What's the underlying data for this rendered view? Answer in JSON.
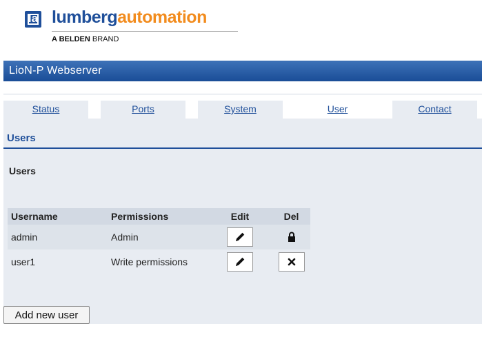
{
  "brand": {
    "name_part1": "lumberg",
    "name_part2": "automation",
    "tagline_bold": "A BELDEN",
    "tagline_rest": " BRAND",
    "mark": "la"
  },
  "header": {
    "title": "LioN-P Webserver"
  },
  "tabs": [
    {
      "label": "Status",
      "active": false
    },
    {
      "label": "Ports",
      "active": false
    },
    {
      "label": "System",
      "active": false
    },
    {
      "label": "User",
      "active": true
    },
    {
      "label": "Contact",
      "active": false
    }
  ],
  "section": {
    "title": "Users",
    "subtitle": "Users"
  },
  "table": {
    "headers": [
      "Username",
      "Permissions",
      "Edit",
      "Del"
    ],
    "rows": [
      {
        "username": "admin",
        "permissions": "Admin",
        "edit": "pencil-icon",
        "del": "lock-icon"
      },
      {
        "username": "user1",
        "permissions": "Write permissions",
        "edit": "pencil-icon",
        "del": "x-icon"
      }
    ]
  },
  "actions": {
    "add_user": "Add new user"
  },
  "colors": {
    "accent": "#1f4f9a",
    "brand_orange": "#f28c1e",
    "panel": "#e8ecf2"
  }
}
